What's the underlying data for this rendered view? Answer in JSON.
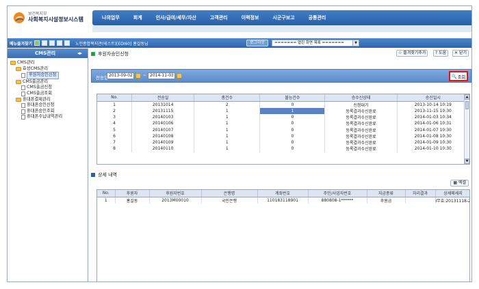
{
  "header": {
    "ministry": "보건복지부",
    "system_name": "사회복지시설정보시스템",
    "menu": [
      "나의업무",
      "회계",
      "인사/급여/세무/자산",
      "고객관리",
      "이력정보",
      "시군구보고",
      "공통관리"
    ]
  },
  "toolbar": {
    "favorites_label": "메뉴즐겨찾기",
    "breadcrumb": "노인종합복지관(테스트)[EDI60] 홍길동님",
    "logout_label": "로그아웃",
    "open_screens": "======= 열린 화면 목록 ======="
  },
  "sidebar": {
    "title": "CMS관리",
    "items": [
      {
        "label": "CMS관리",
        "level": 0,
        "type": "folder"
      },
      {
        "label": "효성CMS관리",
        "level": 1,
        "type": "folder"
      },
      {
        "label": "후원자승인신청",
        "level": 2,
        "type": "doc",
        "selected": true
      },
      {
        "label": "CMS출금관리",
        "level": 1,
        "type": "folder"
      },
      {
        "label": "CMS출금신청",
        "level": 2,
        "type": "doc"
      },
      {
        "label": "CMS출금조회",
        "level": 2,
        "type": "doc"
      },
      {
        "label": "휴대폰결제관리",
        "level": 1,
        "type": "folder"
      },
      {
        "label": "휴대폰승인신청",
        "level": 2,
        "type": "doc"
      },
      {
        "label": "휴대폰승인조회",
        "level": 2,
        "type": "doc"
      },
      {
        "label": "휴대폰수납내역관리",
        "level": 2,
        "type": "doc"
      }
    ]
  },
  "main": {
    "title": "후원자승인신청",
    "buttons": {
      "favorite_add": "즐겨찾기추가",
      "help": "도움",
      "close": "닫기"
    },
    "search": {
      "label": "전송일",
      "date_from": "2013-09-02",
      "date_to": "2014-11-03",
      "query_label": "조회"
    },
    "grid1": {
      "columns": [
        "No.",
        "전송일",
        "총건수",
        "불능건수",
        "승수신상태",
        "승신일시"
      ],
      "rows": [
        [
          "1",
          "20131014",
          "2",
          "0",
          "신청대기",
          "2013-10-14 10:19"
        ],
        [
          "2",
          "20131115",
          "1",
          "1",
          "등록결과수신완료",
          "2013-11-15 10:30"
        ],
        [
          "3",
          "20140103",
          "1",
          "0",
          "등록결과수신완료",
          "2014-01-03 10:34"
        ],
        [
          "4",
          "20140106",
          "1",
          "0",
          "등록결과수신완료",
          "2014-01-06 10:31"
        ],
        [
          "5",
          "20140107",
          "1",
          "0",
          "등록결과수신완료",
          "2014-01-07 10:30"
        ],
        [
          "6",
          "20140108",
          "1",
          "0",
          "등록결과수신완료",
          "2014-01-08 10:30"
        ],
        [
          "7",
          "20140109",
          "1",
          "0",
          "등록결과수신완료",
          "2014-01-09 10:30"
        ],
        [
          "8",
          "20140110",
          "1",
          "0",
          "등록결과수신완료",
          "2014-01-10 10:30"
        ]
      ]
    },
    "detail": {
      "title": "상세 내역",
      "excel_label": "엑셀",
      "columns": [
        "No.",
        "후원자",
        "후원자번호",
        "은행명",
        "계좌번호",
        "주민/사업자번호",
        "자금종류",
        "처리결과",
        "상세메세지"
      ],
      "rows": [
        [
          "1",
          "홍길동",
          "2013M00010",
          "국민은행",
          "110183118901",
          "880808-1******",
          "후원금",
          "",
          "I무효:20131118-2"
        ]
      ]
    }
  }
}
